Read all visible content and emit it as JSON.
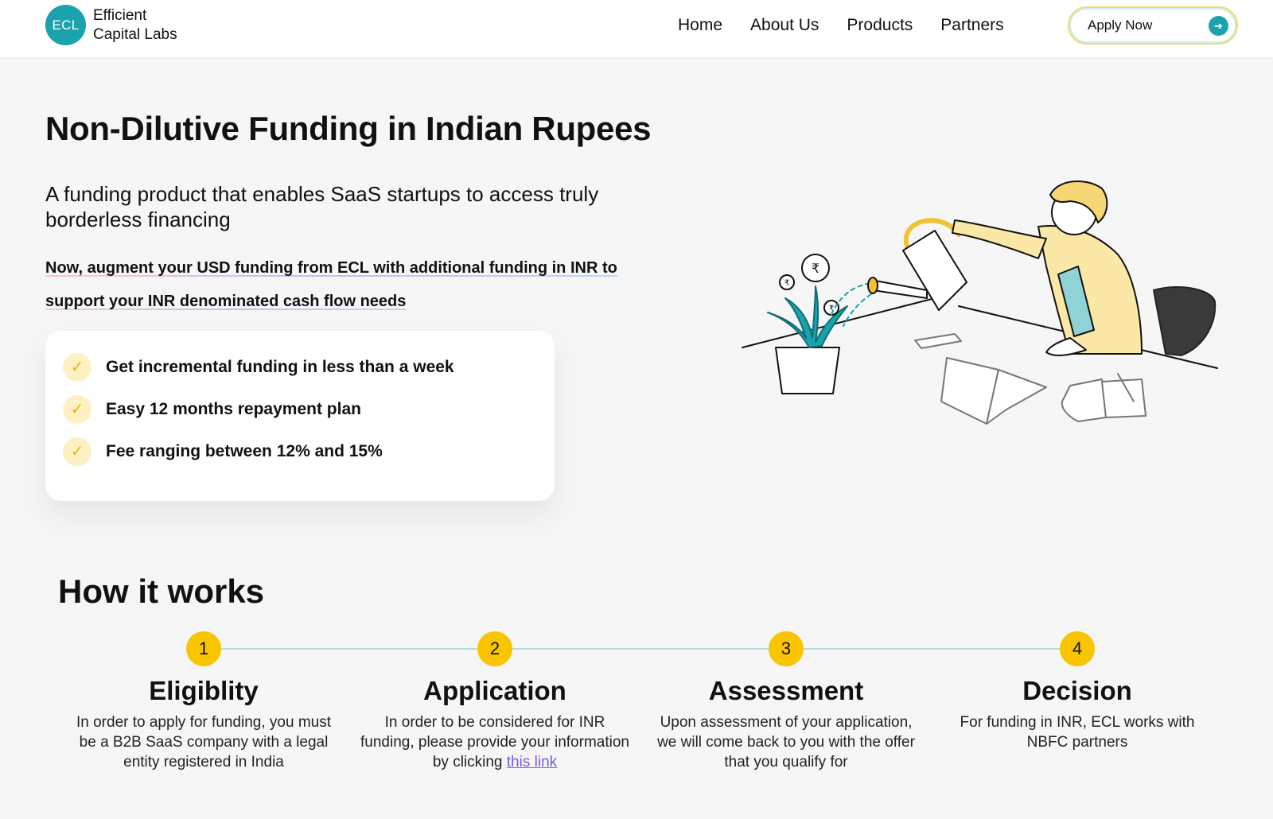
{
  "header": {
    "logo_badge": "ECL",
    "logo_line1": "Efficient",
    "logo_line2": "Capital Labs",
    "nav": [
      "Home",
      "About Us",
      "Products",
      "Partners"
    ],
    "apply_label": "Apply Now",
    "apply_icon": "arrow-right-icon"
  },
  "hero": {
    "title": "Non-Dilutive Funding in Indian Rupees",
    "subtitle": "A funding product that enables SaaS startups to access truly borderless financing",
    "highlight_line1": "Now, augment your USD funding from ECL with additional funding in INR to",
    "highlight_line2": "support your INR denominated cash flow needs",
    "benefits": [
      "Get incremental funding in less than a week",
      "Easy 12 months repayment plan",
      "Fee ranging between 12% and 15%"
    ],
    "illustration_symbols": [
      "₹",
      "₹",
      "₹"
    ]
  },
  "how_it_works": {
    "title": "How it works",
    "steps": [
      {
        "num": "1",
        "title": "Eligiblity",
        "desc": "In order to apply for funding, you must be a B2B SaaS company with a legal entity registered in India"
      },
      {
        "num": "2",
        "title": "Application",
        "desc_prefix": "In order to be considered for INR funding, please provide your information by clicking ",
        "link": "this link"
      },
      {
        "num": "3",
        "title": "Assessment",
        "desc": "Upon assessment of your application, we will come back to you with the offer that you qualify for"
      },
      {
        "num": "4",
        "title": "Decision",
        "desc": "For funding in INR, ECL works with NBFC partners"
      }
    ]
  },
  "colors": {
    "brand_teal": "#1aa3ad",
    "accent_yellow": "#f9c400",
    "background": "#f6f6f6",
    "link_purple": "#7c5bd6"
  }
}
